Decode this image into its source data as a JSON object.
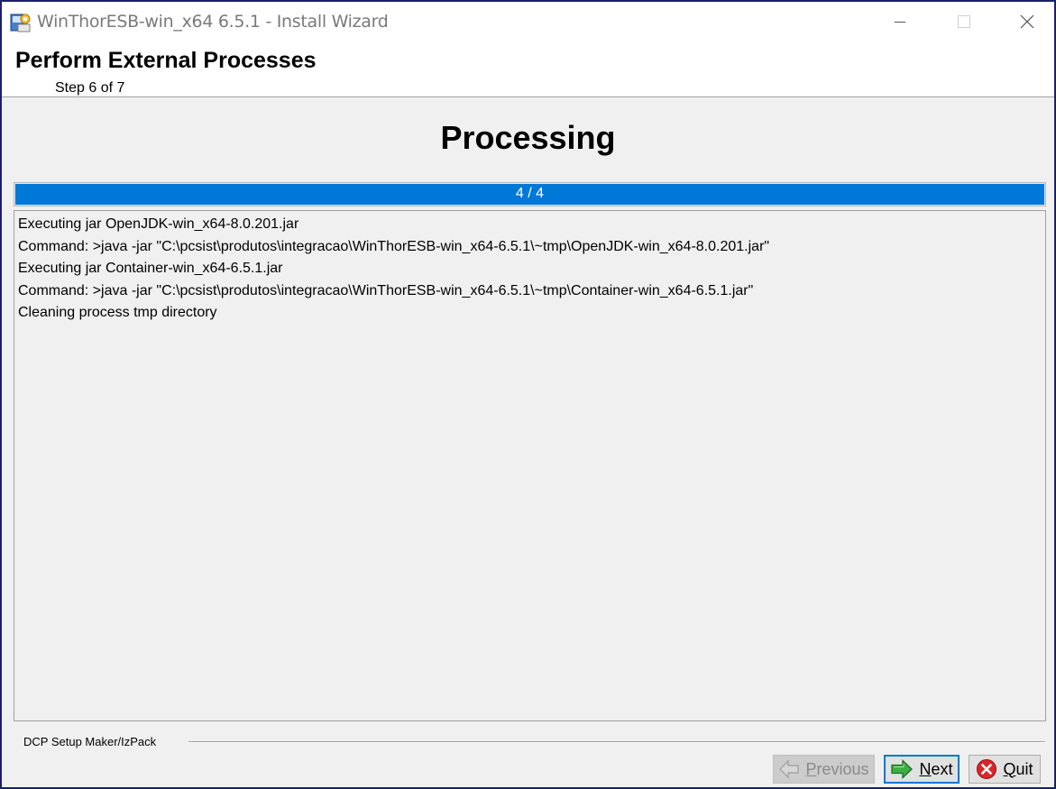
{
  "window": {
    "title": "WinThorESB-win_x64 6.5.1 - Install Wizard"
  },
  "header": {
    "title": "Perform External Processes",
    "step": "Step 6 of 7"
  },
  "main": {
    "heading": "Processing",
    "progress": {
      "label": "4 / 4",
      "value": 4,
      "max": 4
    },
    "log": [
      "Executing jar OpenJDK-win_x64-8.0.201.jar",
      "Command: >java -jar \"C:\\pcsist\\produtos\\integracao\\WinThorESB-win_x64-6.5.1\\~tmp\\OpenJDK-win_x64-8.0.201.jar\"",
      "Executing jar Container-win_x64-6.5.1.jar",
      "Command: >java -jar \"C:\\pcsist\\produtos\\integracao\\WinThorESB-win_x64-6.5.1\\~tmp\\Container-win_x64-6.5.1.jar\"",
      "Cleaning process tmp directory"
    ]
  },
  "footer": {
    "brand": "DCP Setup Maker/IzPack",
    "buttons": {
      "previous": {
        "mnemonic": "P",
        "rest": "revious",
        "enabled": false
      },
      "next": {
        "mnemonic": "N",
        "rest": "ext",
        "enabled": true
      },
      "quit": {
        "mnemonic": "Q",
        "rest": "uit",
        "enabled": true
      }
    }
  },
  "colors": {
    "accent": "#0078d7",
    "window_border": "#1a1f6e",
    "quit_icon": "#d9262b",
    "next_icon": "#3cb043"
  },
  "icons": {
    "app": "installer-icon",
    "previous": "arrow-left-icon",
    "next": "arrow-right-icon",
    "quit": "stop-icon"
  }
}
